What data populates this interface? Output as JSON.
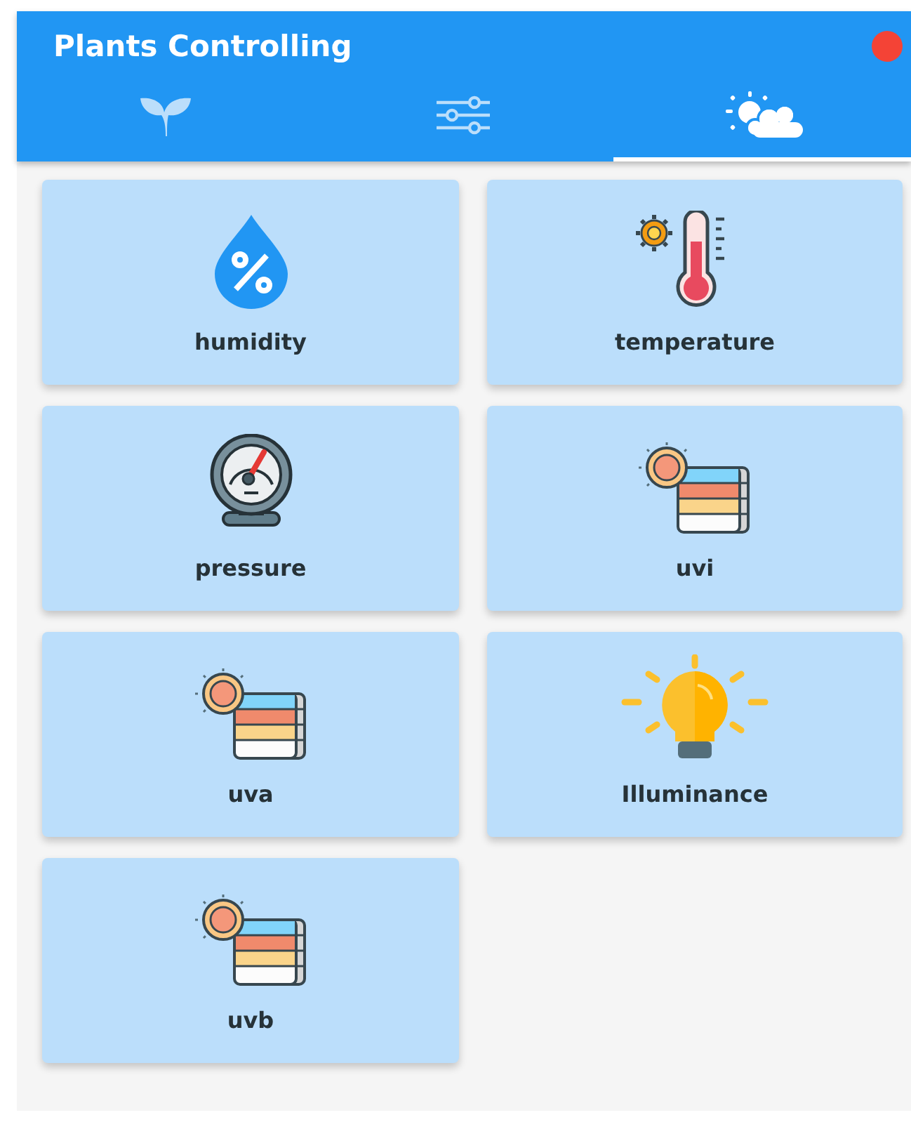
{
  "app_bar": {
    "title": "Plants Controlling"
  },
  "tabs": [
    {
      "kind": "plant",
      "selected": false
    },
    {
      "kind": "sliders",
      "selected": false
    },
    {
      "kind": "weather",
      "selected": true
    }
  ],
  "cards": [
    {
      "kind": "drop",
      "label": "humidity"
    },
    {
      "kind": "thermometer",
      "label": "temperature"
    },
    {
      "kind": "gauge",
      "label": "pressure"
    },
    {
      "kind": "uv",
      "label": "uvi"
    },
    {
      "kind": "uv",
      "label": "uva"
    },
    {
      "kind": "bulb",
      "label": "Illuminance"
    },
    {
      "kind": "uv",
      "label": "uvb"
    }
  ]
}
